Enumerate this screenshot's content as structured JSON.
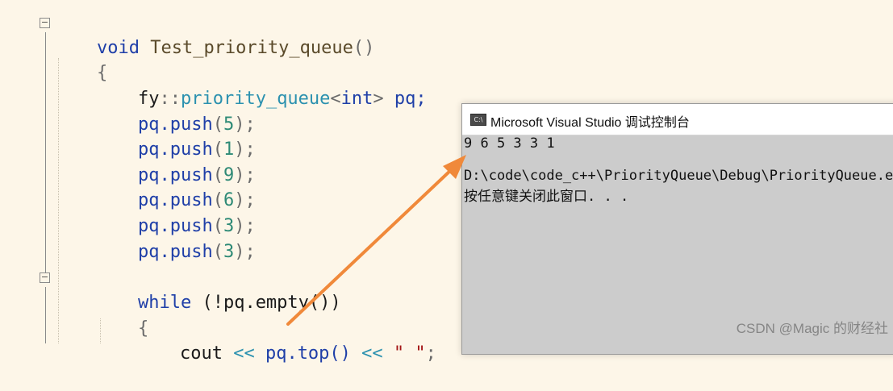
{
  "editor": {
    "line1": {
      "kw": "void",
      "name": " Test_priority_queue",
      "paren": "()"
    },
    "line2": {
      "brace": "{"
    },
    "line3": {
      "ns": "fy",
      "sep": "::",
      "type": "priority_queue",
      "lt": "<",
      "targ": "int",
      "gt": ">",
      "var": " pq;"
    },
    "pushes": [
      {
        "obj": "pq.push",
        "open": "(",
        "arg": "5",
        "close": ");"
      },
      {
        "obj": "pq.push",
        "open": "(",
        "arg": "1",
        "close": ");"
      },
      {
        "obj": "pq.push",
        "open": "(",
        "arg": "9",
        "close": ");"
      },
      {
        "obj": "pq.push",
        "open": "(",
        "arg": "6",
        "close": ");"
      },
      {
        "obj": "pq.push",
        "open": "(",
        "arg": "3",
        "close": ");"
      },
      {
        "obj": "pq.push",
        "open": "(",
        "arg": "3",
        "close": ");"
      }
    ],
    "while_line": {
      "kw": "while",
      "cond": " (!pq.empty())"
    },
    "inner_brace": "{",
    "cout_line": {
      "cout": "cout",
      "op1": " << ",
      "call": "pq.top()",
      "op2": " << ",
      "str": "\" \"",
      "end": ";"
    },
    "fold_minus": "−"
  },
  "console": {
    "title": "Microsoft Visual Studio 调试控制台",
    "icon_label": "C:\\",
    "output": "9 6 5 3 3 1",
    "path": "D:\\code\\code_c++\\PriorityQueue\\Debug\\PriorityQueue.exe",
    "prompt": "按任意键关闭此窗口. . ."
  },
  "colors": {
    "arrow": "#f0893a",
    "keyword": "#1f3fa8",
    "type": "#2b91af",
    "number": "#2e8a76"
  },
  "icons": [
    "fold-collapse-icon",
    "console-app-icon",
    "arrow-annotation"
  ],
  "watermark": "CSDN @Magic 的财经社"
}
